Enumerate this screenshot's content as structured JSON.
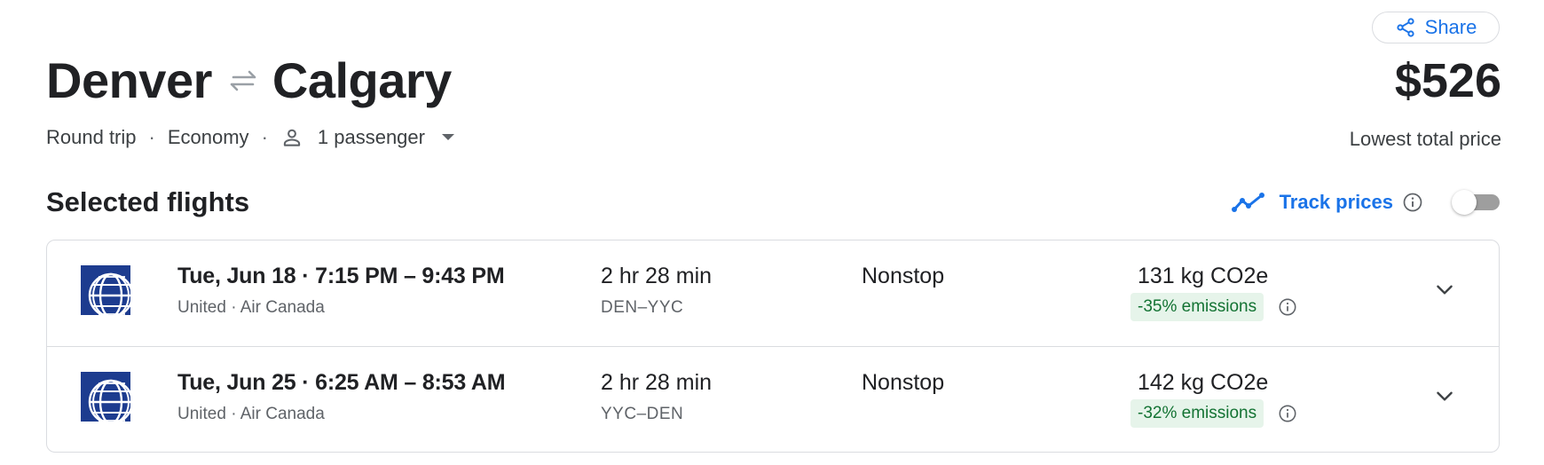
{
  "header": {
    "share_label": "Share",
    "origin": "Denver",
    "destination": "Calgary",
    "swap_icon": "swap-arrows-icon",
    "price": "$526",
    "price_caption": "Lowest total price",
    "trip_type": "Round trip",
    "cabin_class": "Economy",
    "passengers": "1 passenger"
  },
  "selected": {
    "title": "Selected flights",
    "track_label": "Track prices",
    "track_enabled": false
  },
  "flights": [
    {
      "date": "Tue, Jun 18",
      "times": "7:15 PM – 9:43 PM",
      "airlines": "United · Air Canada",
      "duration": "2 hr 28 min",
      "route": "DEN–YYC",
      "stops": "Nonstop",
      "co2": "131 kg CO2e",
      "emissions": "-35% emissions"
    },
    {
      "date": "Tue, Jun 25",
      "times": "6:25 AM – 8:53 AM",
      "airlines": "United · Air Canada",
      "duration": "2 hr 28 min",
      "route": "YYC–DEN",
      "stops": "Nonstop",
      "co2": "142 kg CO2e",
      "emissions": "-32% emissions"
    }
  ],
  "colors": {
    "accent": "#1a73e8",
    "emission_bg": "#e6f4ea",
    "emission_text": "#137333",
    "united_blue": "#1d3c8f"
  }
}
